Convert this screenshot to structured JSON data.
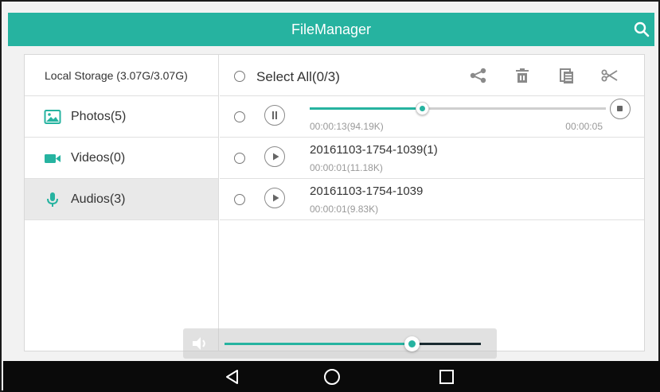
{
  "app": {
    "title": "FileManager"
  },
  "sidebar": {
    "storage_label": "Local Storage (3.07G/3.07G)",
    "items": [
      {
        "label": "Photos(5)",
        "icon": "image-icon",
        "active": false
      },
      {
        "label": "Videos(0)",
        "icon": "video-camera-icon",
        "active": false
      },
      {
        "label": "Audios(3)",
        "icon": "microphone-icon",
        "active": true
      }
    ]
  },
  "toolbar": {
    "select_all_label": "Select All(0/3)",
    "icons": [
      "share-icon",
      "delete-icon",
      "copy-icon",
      "cut-icon"
    ]
  },
  "files": [
    {
      "state": "playing",
      "elapsed": "00:00:13(94.19K)",
      "duration": "00:00:05",
      "progress": 0.38
    },
    {
      "state": "stopped",
      "name": "20161103-1754-1039(1)",
      "meta": "00:00:01(11.18K)"
    },
    {
      "state": "stopped",
      "name": "20161103-1754-1039",
      "meta": "00:00:01(9.83K)"
    }
  ],
  "volume": {
    "level": 0.73
  },
  "colors": {
    "accent": "#26b3a0",
    "navbar": "#0a0a0a"
  }
}
